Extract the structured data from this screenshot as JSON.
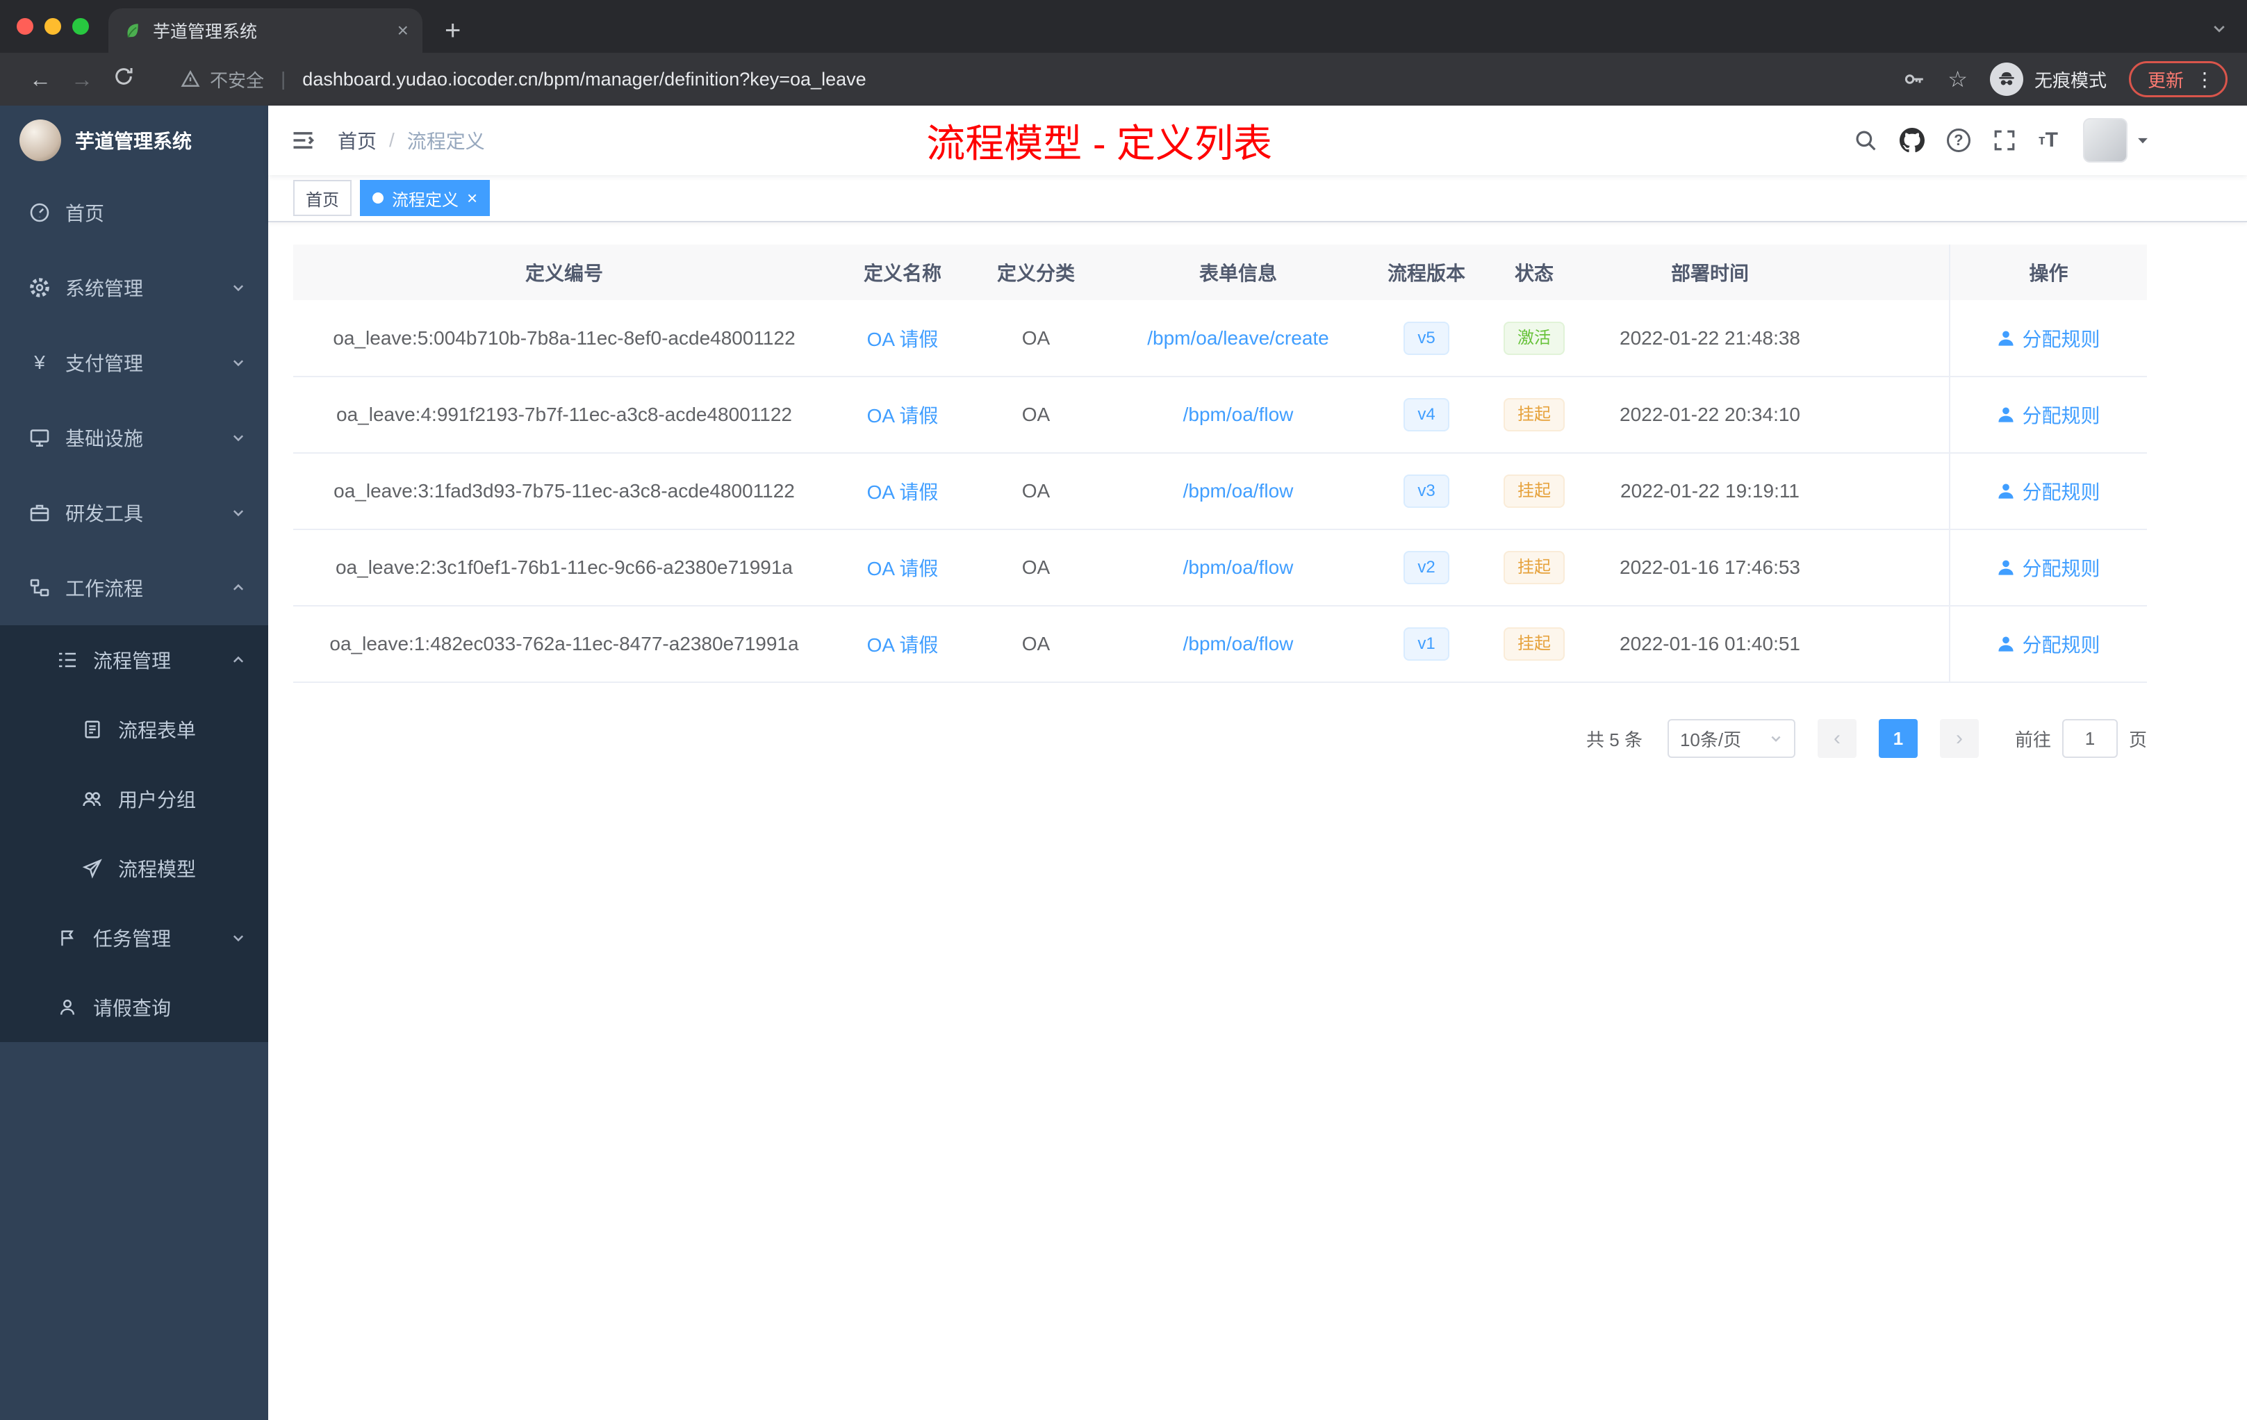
{
  "browser": {
    "tab_title": "芋道管理系统",
    "security_label": "不安全",
    "url": "dashboard.yudao.iocoder.cn/bpm/manager/definition?key=oa_leave",
    "incognito_label": "无痕模式",
    "update_label": "更新"
  },
  "sidebar": {
    "logo_title": "芋道管理系统",
    "items": [
      {
        "label": "首页"
      },
      {
        "label": "系统管理"
      },
      {
        "label": "支付管理"
      },
      {
        "label": "基础设施"
      },
      {
        "label": "研发工具"
      },
      {
        "label": "工作流程"
      },
      {
        "label": "流程管理"
      },
      {
        "label": "流程表单"
      },
      {
        "label": "用户分组"
      },
      {
        "label": "流程模型"
      },
      {
        "label": "任务管理"
      },
      {
        "label": "请假查询"
      }
    ]
  },
  "navbar": {
    "breadcrumb_home": "首页",
    "breadcrumb_sep": "/",
    "breadcrumb_current": "流程定义",
    "annotation": "流程模型 - 定义列表"
  },
  "tags": {
    "home": "首页",
    "current": "流程定义"
  },
  "table": {
    "headers": [
      "定义编号",
      "定义名称",
      "定义分类",
      "表单信息",
      "流程版本",
      "状态",
      "部署时间",
      "操作"
    ],
    "rows": [
      {
        "id": "oa_leave:5:004b710b-7b8a-11ec-8ef0-acde48001122",
        "name": "OA 请假",
        "category": "OA",
        "form": "/bpm/oa/leave/create",
        "version": "v5",
        "status": "激活",
        "time": "2022-01-22 21:48:38",
        "action": "分配规则"
      },
      {
        "id": "oa_leave:4:991f2193-7b7f-11ec-a3c8-acde48001122",
        "name": "OA 请假",
        "category": "OA",
        "form": "/bpm/oa/flow",
        "version": "v4",
        "status": "挂起",
        "time": "2022-01-22 20:34:10",
        "action": "分配规则"
      },
      {
        "id": "oa_leave:3:1fad3d93-7b75-11ec-a3c8-acde48001122",
        "name": "OA 请假",
        "category": "OA",
        "form": "/bpm/oa/flow",
        "version": "v3",
        "status": "挂起",
        "time": "2022-01-22 19:19:11",
        "action": "分配规则"
      },
      {
        "id": "oa_leave:2:3c1f0ef1-76b1-11ec-9c66-a2380e71991a",
        "name": "OA 请假",
        "category": "OA",
        "form": "/bpm/oa/flow",
        "version": "v2",
        "status": "挂起",
        "time": "2022-01-16 17:46:53",
        "action": "分配规则"
      },
      {
        "id": "oa_leave:1:482ec033-762a-11ec-8477-a2380e71991a",
        "name": "OA 请假",
        "category": "OA",
        "form": "/bpm/oa/flow",
        "version": "v1",
        "status": "挂起",
        "time": "2022-01-16 01:40:51",
        "action": "分配规则"
      }
    ]
  },
  "pagination": {
    "total": "共 5 条",
    "page_size": "10条/页",
    "current_page": "1",
    "goto_label": "前往",
    "goto_value": "1",
    "page_unit": "页"
  },
  "colors": {
    "accent": "#409eff",
    "success": "#67c23a",
    "warning": "#e6a23c",
    "annotation_red": "#ff0000",
    "sidebar_bg": "#304156",
    "submenu_bg": "#1f2d3d"
  }
}
